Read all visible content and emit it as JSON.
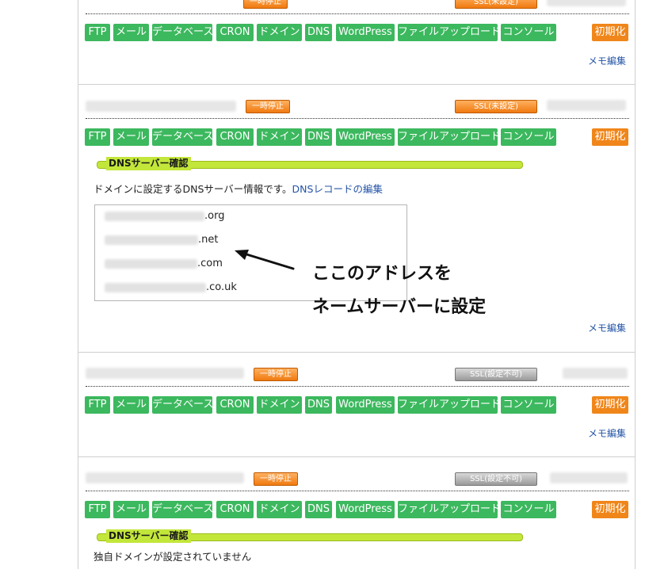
{
  "labels": {
    "pause": "一時停止",
    "ssl_unset": "SSL(未設定)",
    "ssl_disabled": "SSL(設定不可)",
    "init": "初期化",
    "memo": "メモ編集",
    "dns_header": "DNSサーバー確認"
  },
  "menu": [
    "FTP",
    "メール",
    "データベース",
    "CRON",
    "ドメイン",
    "DNS",
    "WordPress",
    "ファイルアップロード",
    "コンソール"
  ],
  "dns_block": {
    "description": "ドメインに設定するDNSサーバー情報です。",
    "link": "DNSレコードの編集",
    "nameservers": [
      ".org",
      ".net",
      ".com",
      ".co.uk"
    ]
  },
  "annotation": {
    "line1": "ここのアドレスを",
    "line2": "ネームサーバーに設定"
  },
  "no_domain_text": "独自ドメインが設定されていません",
  "colors": {
    "green": "#3cb85e",
    "orange": "#f0861a",
    "link": "#2454a6",
    "dns_bar": "#c3e63a"
  }
}
